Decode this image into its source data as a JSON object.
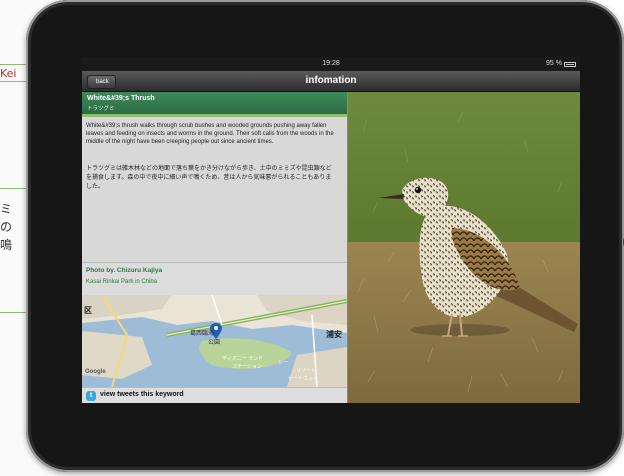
{
  "background_page": {
    "top_text": "Kei",
    "lines": [
      "ミ",
      "の",
      "鳴"
    ]
  },
  "status_bar": {
    "time": "19:28",
    "battery": "95 %"
  },
  "nav": {
    "back_label": "back",
    "title": "infomation"
  },
  "bird": {
    "name": "White&#39;s Thrush",
    "name_jp": "トラツグミ",
    "description": "White&#39;s thrush walks through scrub bushes and wooded grounds pushing away fallen leaves and feeding on insects and worms in the ground.  Their soft calls from the woods in the middle of the night have been creeping people out since ancient times.",
    "description_jp": "トラツグミは雑木林などの地面で落ち葉をかき分けながら歩き、土中のミミズや昆虫類などを捕食します。森の中で夜中に細い声で鳴くため、昔は人から気味悪がられることもありました。"
  },
  "photo_credit": {
    "name": "Photo by. Chizuru Kajiya",
    "place": "Kasai Rinkai Park in Chiba"
  },
  "map": {
    "labels": [
      "区",
      "葛西臨海",
      "公園",
      "浦安",
      "ディズニー ランド",
      "ステーション",
      "シー",
      "リゾート",
      "ゲートウェイ"
    ],
    "logo": "Google"
  },
  "tweet_bar": {
    "label": "view tweets this keyword"
  },
  "colors": {
    "header_green": "#2b6b45",
    "credit_green": "#2c7a3c",
    "twitter_blue": "#38a8e0"
  }
}
